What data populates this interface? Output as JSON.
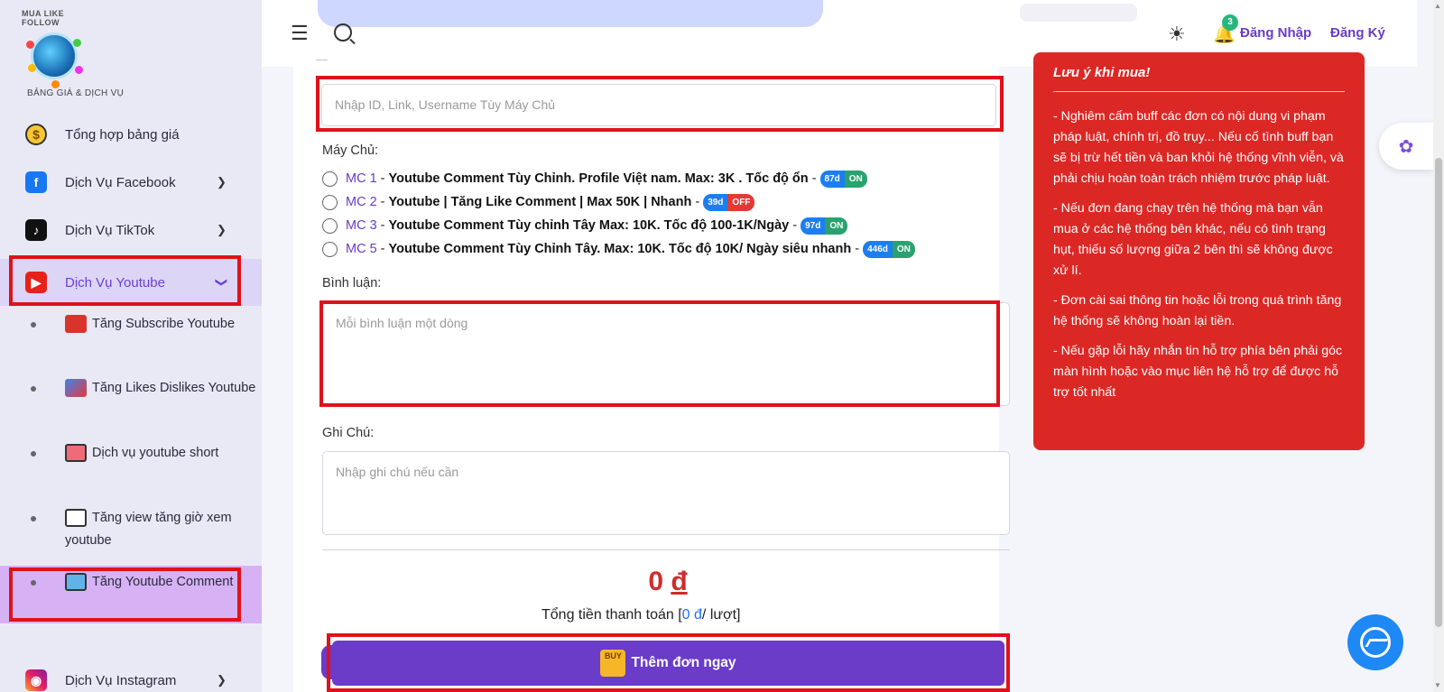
{
  "sidebar": {
    "logo_text": "MUA LIKE FOLLOW",
    "section_title": "BẢNG GIÁ & DỊCH VỤ",
    "items": [
      {
        "label": "Tổng hợp bảng giá",
        "icon": "dollar-coin-icon"
      },
      {
        "label": "Dịch Vụ Facebook",
        "icon": "facebook-icon"
      },
      {
        "label": "Dịch Vụ TikTok",
        "icon": "tiktok-icon"
      },
      {
        "label": "Dịch Vụ Youtube",
        "icon": "youtube-icon"
      },
      {
        "label": "Dịch Vụ Instagram",
        "icon": "instagram-icon"
      }
    ],
    "youtube_sub_items": [
      {
        "label": "Tăng Subscribe Youtube"
      },
      {
        "label": "Tăng Likes Dislikes Youtube"
      },
      {
        "label": "Dịch vụ youtube short"
      },
      {
        "label": "Tăng view tăng giờ xem youtube"
      },
      {
        "label": "Tăng Youtube Comment"
      }
    ]
  },
  "header": {
    "notification_count": "3",
    "login_label": "Đăng Nhập",
    "register_label": "Đăng Ký"
  },
  "form": {
    "link_placeholder": "Nhập ID, Link, Username Tùy Máy Chủ",
    "server_label": "Máy Chủ:",
    "servers": [
      {
        "code": "MC 1",
        "desc": "Youtube Comment Tùy Chỉnh. Profile Việt nam. Max: 3K . Tốc độ ổn",
        "days": "87d",
        "status": "ON"
      },
      {
        "code": "MC 2",
        "desc": "Youtube | Tăng Like Comment | Max 50K | Nhanh",
        "days": "39d",
        "status": "OFF"
      },
      {
        "code": "MC 3",
        "desc": "Youtube Comment Tùy chỉnh Tây Max: 10K. Tốc độ 100-1K/Ngày",
        "days": "97d",
        "status": "ON"
      },
      {
        "code": "MC 5",
        "desc": "Youtube Comment Tùy Chỉnh Tây. Max: 10K. Tốc độ 10K/ Ngày siêu nhanh",
        "days": "446d",
        "status": "ON"
      }
    ],
    "comment_label": "Bình luận:",
    "comment_placeholder": "Mỗi bình luận một dòng",
    "note_label": "Ghi Chú:",
    "note_placeholder": "Nhập ghi chú nếu cần",
    "price_amount": "0",
    "price_currency": "đ",
    "total_prefix": "Tổng tiền thanh toán [",
    "total_value": "0 đ",
    "total_suffix": "/ lượt]",
    "submit_label": "Thêm đơn ngay",
    "buy_icon_text": "BUY"
  },
  "warning": {
    "title": "Lưu ý khi mua!",
    "paragraphs": [
      "- Nghiêm cấm buff các đơn có nội dung vi phạm pháp luật, chính trị, đồ trụy... Nếu cố tình buff bạn sẽ bị trừ hết tiền và ban khỏi hệ thống vĩnh viễn, và phải chịu hoàn toàn trách nhiệm trước pháp luật.",
      "- Nếu đơn đang chạy trên hệ thống mà bạn vẫn mua ở các hệ thống bên khác, nếu có tình trạng hụt, thiếu số lượng giữa 2 bên thì sẽ không được xử lí.",
      "- Đơn cài sai thông tin hoặc lỗi trong quá trình tăng hệ thống sẽ không hoàn lại tiền.",
      "- Nếu gặp lỗi hãy nhắn tin hỗ trợ phía bên phải góc màn hình hoặc vào mục liên hệ hỗ trợ để được hỗ trợ tốt nhất"
    ]
  },
  "colors": {
    "accent": "#6a3cc7",
    "warning_bg": "#dc2825",
    "highlight_box": "#e0111b",
    "price": "#d22b2b"
  }
}
